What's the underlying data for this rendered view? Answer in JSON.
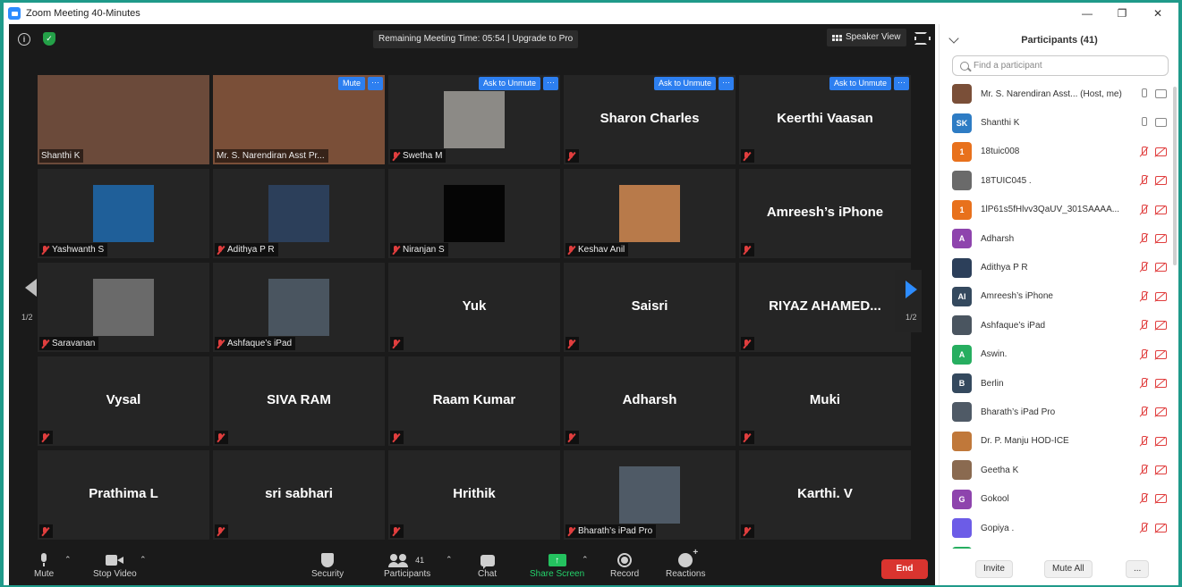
{
  "window": {
    "title": "Zoom Meeting 40-Minutes"
  },
  "topbar": {
    "timer_text": "Remaining Meeting Time: 05:54 | Upgrade to Pro",
    "speaker_view_label": "Speaker View"
  },
  "tiles": [
    {
      "label": "Shanthi K",
      "big": "",
      "photo": "#6b4a3a",
      "full": true,
      "mic_off": false
    },
    {
      "label": "Mr. S. Narendiran Asst Pr...",
      "big": "",
      "photo": "#7a4f38",
      "full": true,
      "mic_off": false,
      "button": "Mute",
      "active": true
    },
    {
      "label": "Swetha M",
      "big": "",
      "photo": "#8c8a86",
      "full": false,
      "mic_off": true,
      "button": "Ask to Unmute"
    },
    {
      "label": "",
      "big": "Sharon Charles",
      "photo": "",
      "mic_off": true,
      "button": "Ask to Unmute"
    },
    {
      "label": "",
      "big": "Keerthi Vaasan",
      "photo": "",
      "mic_off": true,
      "button": "Ask to Unmute"
    },
    {
      "label": "Yashwanth S",
      "big": "",
      "photo": "#1f5f99",
      "full": false,
      "mic_off": true
    },
    {
      "label": "Adithya P R",
      "big": "",
      "photo": "#2c3f5a",
      "full": false,
      "mic_off": true
    },
    {
      "label": "Niranjan S",
      "big": "",
      "photo": "#050505",
      "full": false,
      "mic_off": true
    },
    {
      "label": "Keshav Anil",
      "big": "",
      "photo": "#b87a4a",
      "full": false,
      "mic_off": true
    },
    {
      "label": "",
      "big": "Amreesh’s iPhone",
      "photo": "",
      "mic_off": true
    },
    {
      "label": "Saravanan",
      "big": "",
      "photo": "#6a6a6a",
      "full": false,
      "mic_off": true
    },
    {
      "label": "Ashfaque’s iPad",
      "big": "",
      "photo": "#4a5560",
      "full": false,
      "mic_off": true
    },
    {
      "label": "",
      "big": "Yuk",
      "photo": "",
      "mic_off": true
    },
    {
      "label": "",
      "big": "Saisri",
      "photo": "",
      "mic_off": true
    },
    {
      "label": "",
      "big": "RIYAZ  AHAMED...",
      "photo": "",
      "mic_off": true
    },
    {
      "label": "",
      "big": "Vysal",
      "photo": "",
      "mic_off": true
    },
    {
      "label": "",
      "big": "SIVA RAM",
      "photo": "",
      "mic_off": true
    },
    {
      "label": "",
      "big": "Raam Kumar",
      "photo": "",
      "mic_off": true
    },
    {
      "label": "",
      "big": "Adharsh",
      "photo": "",
      "mic_off": true
    },
    {
      "label": "",
      "big": "Muki",
      "photo": "",
      "mic_off": true
    },
    {
      "label": "",
      "big": "Prathima L",
      "photo": "",
      "mic_off": true
    },
    {
      "label": "",
      "big": "sri sabhari",
      "photo": "",
      "mic_off": true
    },
    {
      "label": "",
      "big": "Hrithik",
      "photo": "",
      "mic_off": true
    },
    {
      "label": "Bharath’s iPad Pro",
      "big": "",
      "photo": "#4f5a66",
      "full": false,
      "mic_off": true
    },
    {
      "label": "",
      "big": "Karthi. V",
      "photo": "",
      "mic_off": true
    }
  ],
  "pager": {
    "left_label": "1/2",
    "right_label": "1/2"
  },
  "toolbar": {
    "mute": "Mute",
    "stop_video": "Stop Video",
    "security": "Security",
    "participants": "Participants",
    "participants_count": "41",
    "chat": "Chat",
    "share_screen": "Share Screen",
    "record": "Record",
    "reactions": "Reactions",
    "end": "End"
  },
  "panel": {
    "title": "Participants (41)",
    "search_placeholder": "Find a participant",
    "invite": "Invite",
    "mute_all": "Mute All",
    "more": "..."
  },
  "participants": [
    {
      "name": "Mr. S. Narendiran Asst... (Host, me)",
      "avatar": "",
      "color": "#7a4f38",
      "muted": false
    },
    {
      "name": "Shanthi K",
      "avatar": "SK",
      "color": "#2e7cc4",
      "muted": false
    },
    {
      "name": "18tuic008",
      "avatar": "1",
      "color": "#e8711c",
      "muted": true
    },
    {
      "name": "18TUIC045 .",
      "avatar": "",
      "color": "#6a6a6a",
      "muted": true
    },
    {
      "name": "1lP61s5fHlvv3QaUV_301SAAAA...",
      "avatar": "1",
      "color": "#e8711c",
      "muted": true
    },
    {
      "name": "Adharsh",
      "avatar": "A",
      "color": "#8e44ad",
      "muted": true
    },
    {
      "name": "Adithya P R",
      "avatar": "",
      "color": "#2c3f5a",
      "muted": true
    },
    {
      "name": "Amreesh’s iPhone",
      "avatar": "AI",
      "color": "#34495e",
      "muted": true
    },
    {
      "name": "Ashfaque’s iPad",
      "avatar": "",
      "color": "#4a5560",
      "muted": true
    },
    {
      "name": "Aswin.",
      "avatar": "A",
      "color": "#27ae60",
      "muted": true
    },
    {
      "name": "Berlin",
      "avatar": "B",
      "color": "#34495e",
      "muted": true
    },
    {
      "name": "Bharath’s iPad Pro",
      "avatar": "",
      "color": "#4f5a66",
      "muted": true
    },
    {
      "name": "Dr. P. Manju HOD-ICE",
      "avatar": "",
      "color": "#c0783a",
      "muted": true
    },
    {
      "name": "Geetha K",
      "avatar": "",
      "color": "#8a6a50",
      "muted": true
    },
    {
      "name": "Gokool",
      "avatar": "G",
      "color": "#8e44ad",
      "muted": true
    },
    {
      "name": "Gopiya .",
      "avatar": "",
      "color": "#6c5ce7",
      "muted": true
    },
    {
      "name": "",
      "avatar": "",
      "color": "#27ae60",
      "muted": true
    }
  ]
}
